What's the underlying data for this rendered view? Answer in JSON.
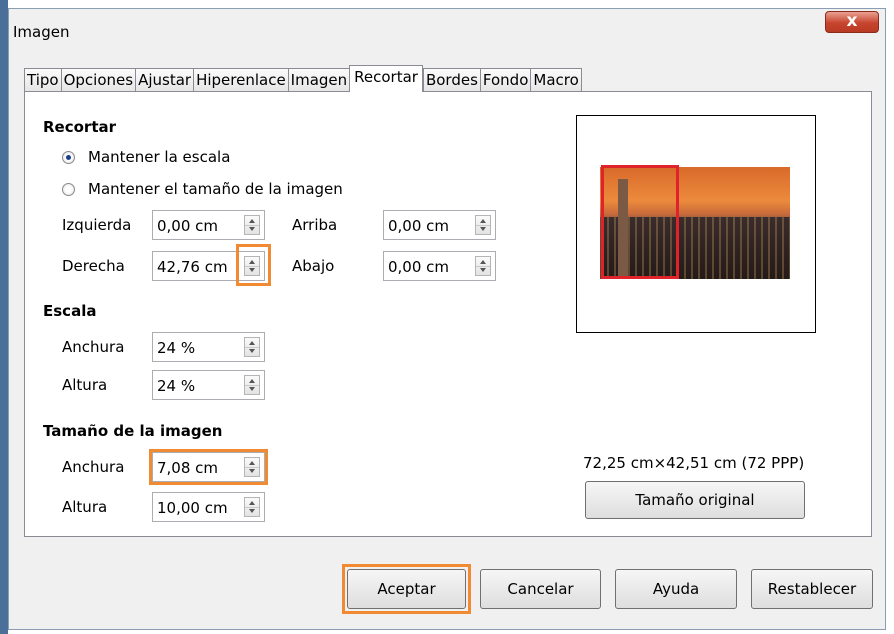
{
  "window": {
    "title": "Imagen",
    "close_label": "x"
  },
  "tabs": [
    "Tipo",
    "Opciones",
    "Ajustar",
    "Hiperenlace",
    "Imagen",
    "Recortar",
    "Bordes",
    "Fondo",
    "Macro"
  ],
  "active_tab": "Recortar",
  "crop": {
    "header": "Recortar",
    "keep_scale_label": "Mantener la escala",
    "keep_size_label": "Mantener el tamaño de la imagen",
    "selected": "keep_scale",
    "left_label": "Izquierda",
    "left_value": "0,00 cm",
    "right_label": "Derecha",
    "right_value": "42,76 cm",
    "top_label": "Arriba",
    "top_value": "0,00 cm",
    "bottom_label": "Abajo",
    "bottom_value": "0,00 cm"
  },
  "scale": {
    "header": "Escala",
    "width_label": "Anchura",
    "width_value": "24 %",
    "height_label": "Altura",
    "height_value": "24 %"
  },
  "image_size": {
    "header": "Tamaño de la imagen",
    "width_label": "Anchura",
    "width_value": "7,08 cm",
    "height_label": "Altura",
    "height_value": "10,00 cm"
  },
  "original": {
    "info": "72,25 cm×42,51 cm (72 PPP)",
    "button_label": "Tamaño original"
  },
  "buttons": {
    "ok": "Aceptar",
    "cancel": "Cancelar",
    "help": "Ayuda",
    "reset": "Restablecer"
  },
  "colors": {
    "highlight": "#f08a33",
    "crop_frame": "#e0232a",
    "title_bg": "#f0f0f0"
  }
}
